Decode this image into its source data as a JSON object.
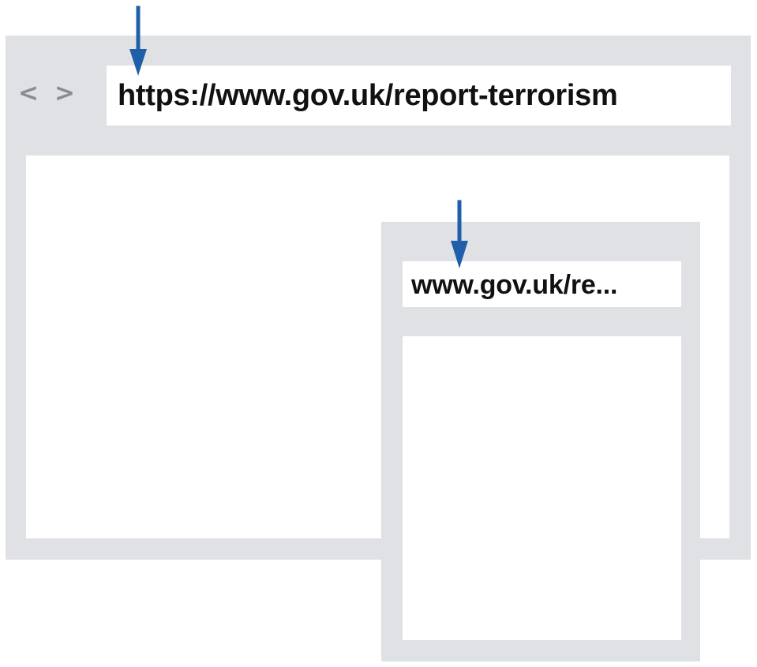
{
  "colors": {
    "frame": "#e0e1e4",
    "page": "#ffffff",
    "url_text": "#111111",
    "nav_text": "#8a8b8f",
    "arrow": "#1f5ea8"
  },
  "desktop": {
    "back_label": "<",
    "forward_label": ">",
    "url": "https://www.gov.uk/report-terrorism"
  },
  "mobile": {
    "url": "www.gov.uk/re..."
  },
  "icons": {
    "desktop_arrow": "down-arrow-icon",
    "mobile_arrow": "down-arrow-icon",
    "back": "chevron-left-icon",
    "forward": "chevron-right-icon"
  }
}
